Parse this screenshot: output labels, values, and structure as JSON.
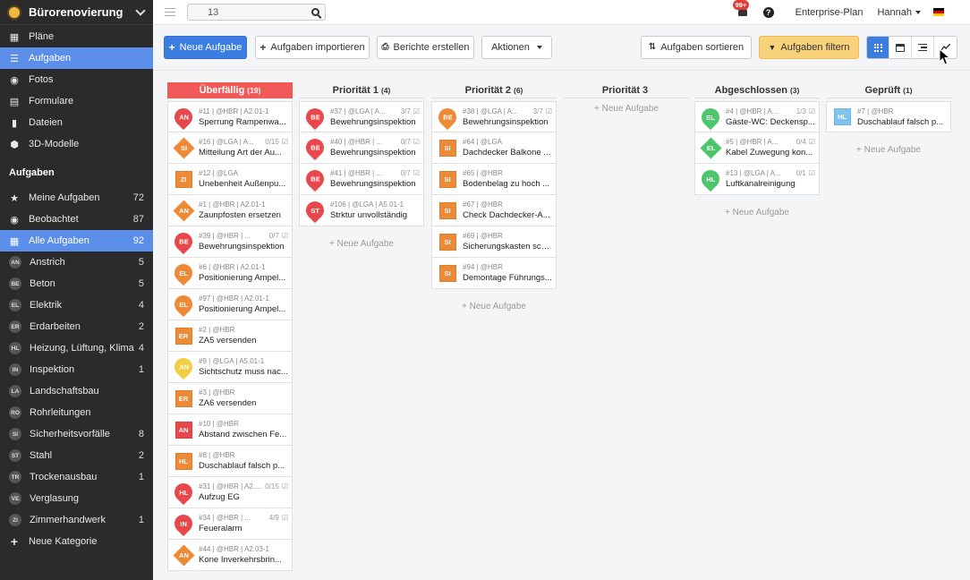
{
  "project": {
    "name": "Bürorenovierung"
  },
  "sidebar": {
    "nav": [
      {
        "label": "Pläne",
        "icon": "plan-icon"
      },
      {
        "label": "Aufgaben",
        "icon": "list-icon"
      },
      {
        "label": "Fotos",
        "icon": "camera-icon"
      },
      {
        "label": "Formulare",
        "icon": "clipboard-icon"
      },
      {
        "label": "Dateien",
        "icon": "file-icon"
      },
      {
        "label": "3D-Modelle",
        "icon": "cube-icon"
      }
    ],
    "tasks_heading": "Aufgaben",
    "filters": [
      {
        "label": "Meine Aufgaben",
        "count": "72",
        "icon": "star-icon"
      },
      {
        "label": "Beobachtet",
        "count": "87",
        "icon": "eye-icon"
      },
      {
        "label": "Alle Aufgaben",
        "count": "92",
        "icon": "grid-icon"
      }
    ],
    "categories": [
      {
        "abbr": "AN",
        "label": "Anstrich",
        "count": "5"
      },
      {
        "abbr": "BE",
        "label": "Beton",
        "count": "5"
      },
      {
        "abbr": "EL",
        "label": "Elektrik",
        "count": "4"
      },
      {
        "abbr": "ER",
        "label": "Erdarbeiten",
        "count": "2"
      },
      {
        "abbr": "HL",
        "label": "Heizung, Lüftung, Klima",
        "count": "4"
      },
      {
        "abbr": "IN",
        "label": "Inspektion",
        "count": "1"
      },
      {
        "abbr": "LA",
        "label": "Landschaftsbau",
        "count": ""
      },
      {
        "abbr": "RO",
        "label": "Rohrleitungen",
        "count": ""
      },
      {
        "abbr": "SI",
        "label": "Sicherheitsvorfälle",
        "count": "8"
      },
      {
        "abbr": "ST",
        "label": "Stahl",
        "count": "2"
      },
      {
        "abbr": "TR",
        "label": "Trockenausbau",
        "count": "1"
      },
      {
        "abbr": "VE",
        "label": "Verglasung",
        "count": ""
      },
      {
        "abbr": "ZI",
        "label": "Zimmerhandwerk",
        "count": "1"
      }
    ],
    "new_category": "Neue Kategorie"
  },
  "topbar": {
    "search_value": "13",
    "notification_badge": "99+",
    "help": "?",
    "plan": "Enterprise-Plan",
    "user": "Hannah"
  },
  "toolbar": {
    "new_task": "Neue Aufgabe",
    "import": "Aufgaben importieren",
    "reports": "Berichte erstellen",
    "actions": "Aktionen",
    "sort": "Aufgaben sortieren",
    "filter": "Aufgaben filtern"
  },
  "colors": {
    "accent": "#3b7de0",
    "overdue": "#f25a5a",
    "red": "#e8484b",
    "orange": "#ee8a35",
    "yellow": "#f3cd44",
    "green": "#4cc66b",
    "light_blue": "#7fc4ee"
  },
  "board": {
    "new_task_label": "+ Neue Aufgabe",
    "columns": [
      {
        "title": "Überfällig",
        "count": "(19)",
        "cards": [
          {
            "meta": "#11 | @HBR | A2.01-1",
            "badge": "",
            "title": "Sperrung Rampenwa...",
            "abbr": "AN",
            "shape": "pin",
            "color": "red"
          },
          {
            "meta": "#16 | @LGA | A...",
            "badge": "0/15",
            "title": "Mitteilung Art der Au...",
            "abbr": "SI",
            "shape": "diamond",
            "color": "orange"
          },
          {
            "meta": "#12 | @LGA",
            "badge": "",
            "title": "Unebenheit Außenpu...",
            "abbr": "ZI",
            "shape": "square",
            "color": "orange"
          },
          {
            "meta": "#1 | @HBR | A2.01-1",
            "badge": "",
            "title": "Zaunpfosten ersetzen",
            "abbr": "AN",
            "shape": "diamond",
            "color": "orange"
          },
          {
            "meta": "#39 | @HBR | ...",
            "badge": "0/7",
            "title": "Bewehrungsinspektion",
            "abbr": "BE",
            "shape": "pin",
            "color": "red"
          },
          {
            "meta": "#6 | @HBR | A2.01-1",
            "badge": "",
            "title": "Positionierung Ampel...",
            "abbr": "EL",
            "shape": "pin",
            "color": "orange"
          },
          {
            "meta": "#97 | @HBR | A2.01-1",
            "badge": "",
            "title": "Positionierung Ampel...",
            "abbr": "EL",
            "shape": "pin",
            "color": "orange"
          },
          {
            "meta": "#2 | @HBR",
            "badge": "",
            "title": "ZA5 versenden",
            "abbr": "ER",
            "shape": "square",
            "color": "orange"
          },
          {
            "meta": "#9 | @LGA | A5.01-1",
            "badge": "",
            "title": "Sichtschutz muss nac...",
            "abbr": "AN",
            "shape": "pin",
            "color": "yellow"
          },
          {
            "meta": "#3 | @HBR",
            "badge": "",
            "title": "ZA6 versenden",
            "abbr": "ER",
            "shape": "square",
            "color": "orange"
          },
          {
            "meta": "#10 | @HBR",
            "badge": "",
            "title": "Abstand zwischen Fe...",
            "abbr": "AN",
            "shape": "square",
            "color": "red"
          },
          {
            "meta": "#8 | @HBR",
            "badge": "",
            "title": "Duschablauf falsch p...",
            "abbr": "HL",
            "shape": "square",
            "color": "orange"
          },
          {
            "meta": "#31 | @HBR | A2.01-1",
            "badge": "0/15",
            "title": "Aufzug EG",
            "abbr": "HL",
            "shape": "pin",
            "color": "red"
          },
          {
            "meta": "#34 | @HBR | ...",
            "badge": "4/9",
            "title": "Feueralarm",
            "abbr": "IN",
            "shape": "pin",
            "color": "red"
          },
          {
            "meta": "#44 | @HBR | A2.03-1",
            "badge": "",
            "title": "Kone Inverkehrsbrin...",
            "abbr": "AN",
            "shape": "diamond",
            "color": "orange"
          }
        ]
      },
      {
        "title": "Priorität 1",
        "count": "(4)",
        "cards": [
          {
            "meta": "#37 | @LGA | A...",
            "badge": "3/7",
            "title": "Bewehrungsinspektion",
            "abbr": "BE",
            "shape": "pin",
            "color": "red"
          },
          {
            "meta": "#40 | @HBR | ...",
            "badge": "0/7",
            "title": "Bewehrungsinspektion",
            "abbr": "BE",
            "shape": "pin",
            "color": "red"
          },
          {
            "meta": "#41 | @HBR | ...",
            "badge": "0/7",
            "title": "Bewehrungsinspektion",
            "abbr": "BE",
            "shape": "pin",
            "color": "red"
          },
          {
            "meta": "#106 | @LGA | A5.01-1",
            "badge": "",
            "title": "Strktur unvollständig",
            "abbr": "ST",
            "shape": "pin",
            "color": "red"
          }
        ]
      },
      {
        "title": "Priorität 2",
        "count": "(6)",
        "cards": [
          {
            "meta": "#38 | @LGA | A...",
            "badge": "3/7",
            "title": "Bewehrungsinspektion",
            "abbr": "BE",
            "shape": "pin",
            "color": "orange"
          },
          {
            "meta": "#64 | @LGA",
            "badge": "",
            "title": "Dachdecker Balkone ...",
            "abbr": "SI",
            "shape": "square",
            "color": "orange"
          },
          {
            "meta": "#65 | @HBR",
            "badge": "",
            "title": "Bodenbelag zu hoch ...",
            "abbr": "SI",
            "shape": "square",
            "color": "orange"
          },
          {
            "meta": "#67 | @HBR",
            "badge": "",
            "title": "Check Dachdecker-A...",
            "abbr": "SI",
            "shape": "square",
            "color": "orange"
          },
          {
            "meta": "#69 | @HBR",
            "badge": "",
            "title": "Sicherungskasten sch...",
            "abbr": "SI",
            "shape": "square",
            "color": "orange"
          },
          {
            "meta": "#94 | @HBR",
            "badge": "",
            "title": "Demontage Führungs...",
            "abbr": "SI",
            "shape": "square",
            "color": "orange"
          }
        ]
      },
      {
        "title": "Priorität 3",
        "count": "",
        "cards": []
      },
      {
        "title": "Abgeschlossen",
        "count": "(3)",
        "cards": [
          {
            "meta": "#4 | @HBR | A...",
            "badge": "1/3",
            "title": "Gäste-WC: Deckensp...",
            "abbr": "EL",
            "shape": "pin",
            "color": "green"
          },
          {
            "meta": "#5 | @HBR | A...",
            "badge": "0/4",
            "title": "Kabel Zuwegung kon...",
            "abbr": "EL",
            "shape": "diamond",
            "color": "green"
          },
          {
            "meta": "#13 | @LGA | A...",
            "badge": "0/1",
            "title": "Luftkanalreinigung",
            "abbr": "HL",
            "shape": "pin",
            "color": "green"
          }
        ]
      },
      {
        "title": "Geprüft",
        "count": "(1)",
        "cards": [
          {
            "meta": "#7 | @HBR",
            "badge": "",
            "title": "Duschablauf falsch p...",
            "abbr": "HL",
            "shape": "square",
            "color": "light_blue"
          }
        ]
      }
    ]
  }
}
